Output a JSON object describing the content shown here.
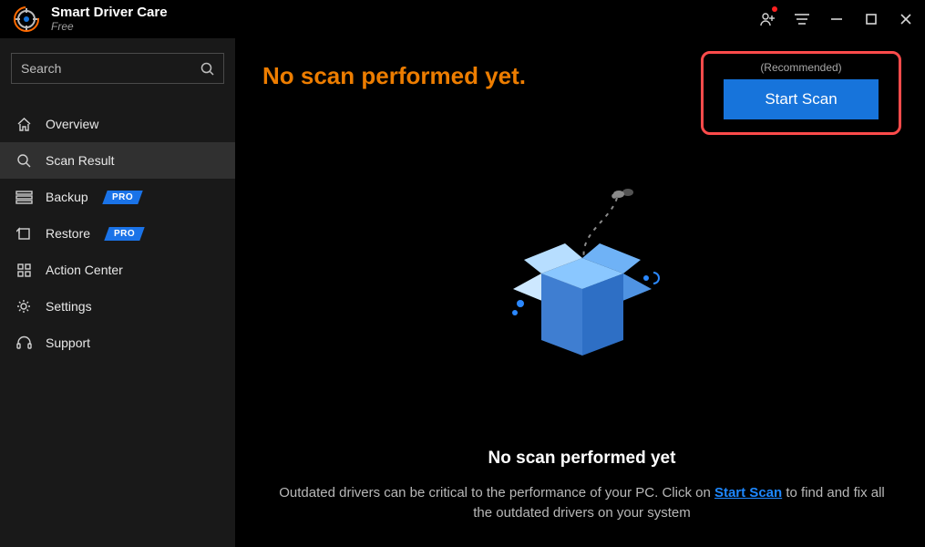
{
  "titlebar": {
    "app_name": "Smart Driver Care",
    "edition": "Free"
  },
  "sidebar": {
    "search_placeholder": "Search",
    "items": [
      {
        "icon": "home-icon",
        "label": "Overview",
        "pro": false
      },
      {
        "icon": "scan-icon",
        "label": "Scan Result",
        "pro": false,
        "selected": true
      },
      {
        "icon": "backup-icon",
        "label": "Backup",
        "pro": true
      },
      {
        "icon": "restore-icon",
        "label": "Restore",
        "pro": true
      },
      {
        "icon": "grid-icon",
        "label": "Action Center",
        "pro": false
      },
      {
        "icon": "gear-icon",
        "label": "Settings",
        "pro": false
      },
      {
        "icon": "headset-icon",
        "label": "Support",
        "pro": false
      }
    ],
    "pro_badge_text": "PRO"
  },
  "main": {
    "headline": "No scan performed yet.",
    "recommended_label": "(Recommended)",
    "start_scan_label": "Start Scan",
    "empty_title": "No scan performed yet",
    "empty_desc_pre": "Outdated drivers can be critical to the performance of your PC. Click on ",
    "empty_desc_link": "Start Scan",
    "empty_desc_post": " to find and fix all the outdated drivers on your system"
  },
  "colors": {
    "accent_orange": "#ed7d00",
    "accent_blue": "#1774db",
    "highlight_red": "#ff4b4b",
    "box_blue_light": "#8ac7ff",
    "box_blue_dark": "#2e6fc5"
  }
}
